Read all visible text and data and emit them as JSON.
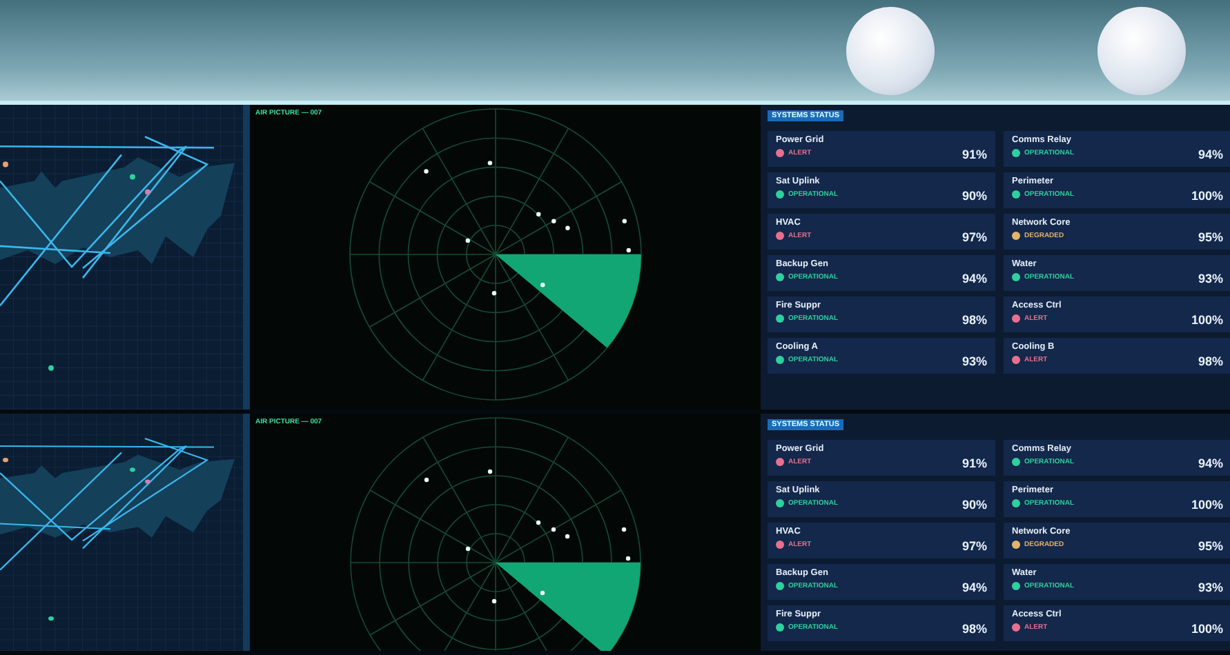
{
  "rows": [
    {
      "air_picture": {
        "title": "AIR PICTURE — 007"
      },
      "systems": {
        "title": "SYSTEMS STATUS",
        "items": [
          {
            "name": "Power Grid",
            "status": "ALERT",
            "kind": "alert",
            "reading": "91%"
          },
          {
            "name": "Comms Relay",
            "status": "OPERATIONAL",
            "kind": "operational",
            "reading": "94%"
          },
          {
            "name": "Sat Uplink",
            "status": "OPERATIONAL",
            "kind": "operational",
            "reading": "90%"
          },
          {
            "name": "Perimeter",
            "status": "OPERATIONAL",
            "kind": "operational",
            "reading": "100%"
          },
          {
            "name": "HVAC",
            "status": "ALERT",
            "kind": "alert",
            "reading": "97%"
          },
          {
            "name": "Network Core",
            "status": "DEGRADED",
            "kind": "degraded",
            "reading": "95%"
          },
          {
            "name": "Backup Gen",
            "status": "OPERATIONAL",
            "kind": "operational",
            "reading": "94%"
          },
          {
            "name": "Water",
            "status": "OPERATIONAL",
            "kind": "operational",
            "reading": "93%"
          },
          {
            "name": "Fire Suppr",
            "status": "OPERATIONAL",
            "kind": "operational",
            "reading": "98%"
          },
          {
            "name": "Access Ctrl",
            "status": "ALERT",
            "kind": "alert",
            "reading": "100%"
          },
          {
            "name": "Cooling A",
            "status": "OPERATIONAL",
            "kind": "operational",
            "reading": "93%"
          },
          {
            "name": "Cooling B",
            "status": "ALERT",
            "kind": "alert",
            "reading": "98%"
          }
        ]
      }
    },
    {
      "air_picture": {
        "title": "AIR PICTURE — 007"
      },
      "systems": {
        "title": "SYSTEMS STATUS",
        "items": [
          {
            "name": "Power Grid",
            "status": "ALERT",
            "kind": "alert",
            "reading": "91%"
          },
          {
            "name": "Comms Relay",
            "status": "OPERATIONAL",
            "kind": "operational",
            "reading": "94%"
          },
          {
            "name": "Sat Uplink",
            "status": "OPERATIONAL",
            "kind": "operational",
            "reading": "90%"
          },
          {
            "name": "Perimeter",
            "status": "OPERATIONAL",
            "kind": "operational",
            "reading": "100%"
          },
          {
            "name": "HVAC",
            "status": "ALERT",
            "kind": "alert",
            "reading": "97%"
          },
          {
            "name": "Network Core",
            "status": "DEGRADED",
            "kind": "degraded",
            "reading": "95%"
          },
          {
            "name": "Backup Gen",
            "status": "OPERATIONAL",
            "kind": "operational",
            "reading": "94%"
          },
          {
            "name": "Water",
            "status": "OPERATIONAL",
            "kind": "operational",
            "reading": "93%"
          },
          {
            "name": "Fire Suppr",
            "status": "OPERATIONAL",
            "kind": "operational",
            "reading": "98%"
          },
          {
            "name": "Access Ctrl",
            "status": "ALERT",
            "kind": "alert",
            "reading": "100%"
          }
        ]
      }
    }
  ]
}
